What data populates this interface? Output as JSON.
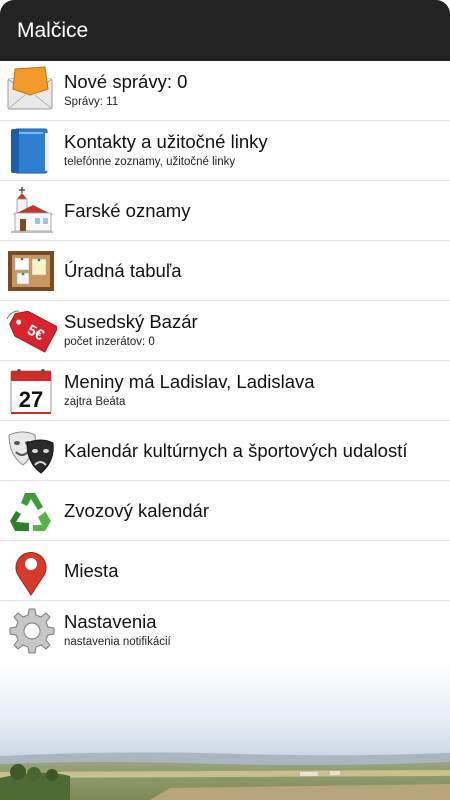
{
  "appbar": {
    "title": "Malčice"
  },
  "menu": {
    "items": [
      {
        "title": "Nové správy: 0",
        "subtitle": "Správy: 11",
        "icon": "envelope-icon"
      },
      {
        "title": "Kontakty a užitočné linky",
        "subtitle": "telefónne zoznamy, užitočné linky",
        "icon": "contact-book-icon"
      },
      {
        "title": "Farské oznamy",
        "subtitle": "",
        "icon": "church-icon"
      },
      {
        "title": "Úradná tabuľa",
        "subtitle": "",
        "icon": "corkboard-icon"
      },
      {
        "title": "Susedský Bazár",
        "subtitle": "počet inzerátov: 0",
        "icon": "price-tag-icon",
        "icon_text": "5€"
      },
      {
        "title": "Meniny má Ladislav, Ladislava",
        "subtitle": "zajtra Beáta",
        "icon": "calendar-icon",
        "icon_text": "27"
      },
      {
        "title": "Kalendár kultúrnych a športových udalostí",
        "subtitle": "",
        "icon": "theater-masks-icon"
      },
      {
        "title": "Zvozový kalendár",
        "subtitle": "",
        "icon": "recycle-icon"
      },
      {
        "title": "Miesta",
        "subtitle": "",
        "icon": "map-pin-icon"
      },
      {
        "title": "Nastavenia",
        "subtitle": "nastavenia notifikácií",
        "icon": "settings-gear-icon"
      }
    ]
  },
  "colors": {
    "appbar": "#232323",
    "divider": "#e2e2e2",
    "tag_red": "#d9232d",
    "pin_red": "#d63a2a",
    "recycle_green": "#3f9b3a"
  }
}
